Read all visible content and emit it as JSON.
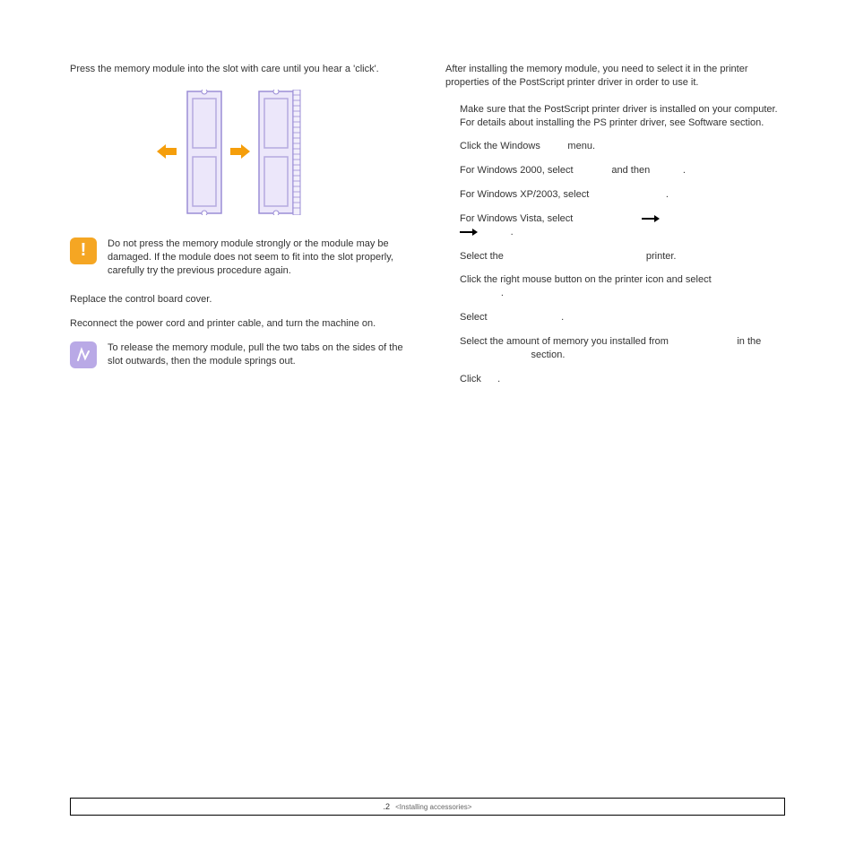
{
  "left": {
    "step_press": "Press the memory module into the slot with care until you hear a 'click'.",
    "warn_text": "Do not press the memory module strongly or the module may be damaged. If the module does not seem to fit into the slot properly, carefully try the previous procedure again.",
    "step_replace": "Replace the control board cover.",
    "step_reconnect": "Reconnect the power cord and printer cable, and turn the machine on.",
    "tip_text": "To release the memory module, pull the two tabs on the sides of the slot outwards, then the module springs out."
  },
  "right": {
    "intro": "After installing the memory module, you need to select it in the printer properties of the PostScript printer driver in order to use it.",
    "s1": "Make sure that the PostScript printer driver is installed on your computer. For details about installing the PS printer driver, see Software section.",
    "s2_a": "Click the Windows ",
    "s2_b": " menu.",
    "s3_a": "For Windows 2000, select ",
    "s3_b": " and then ",
    "s3_c": " .",
    "s4_a": "For Windows XP/2003, select ",
    "s4_b": " .",
    "s5_a": "For Windows Vista, select ",
    "s5_b": " .",
    "s6_a": "Select the ",
    "s6_b": " printer.",
    "s7_a": "Click the right mouse button on the printer icon and select",
    "s7_b": ".",
    "s8_a": "Select ",
    "s8_b": " .",
    "s9_a": "Select the amount of memory you installed from ",
    "s9_b": " in the ",
    "s9_c": " section.",
    "s10_a": "Click ",
    "s10_b": " ."
  },
  "footer": {
    "page": ".2",
    "chapter": "<Installing accessories>"
  }
}
